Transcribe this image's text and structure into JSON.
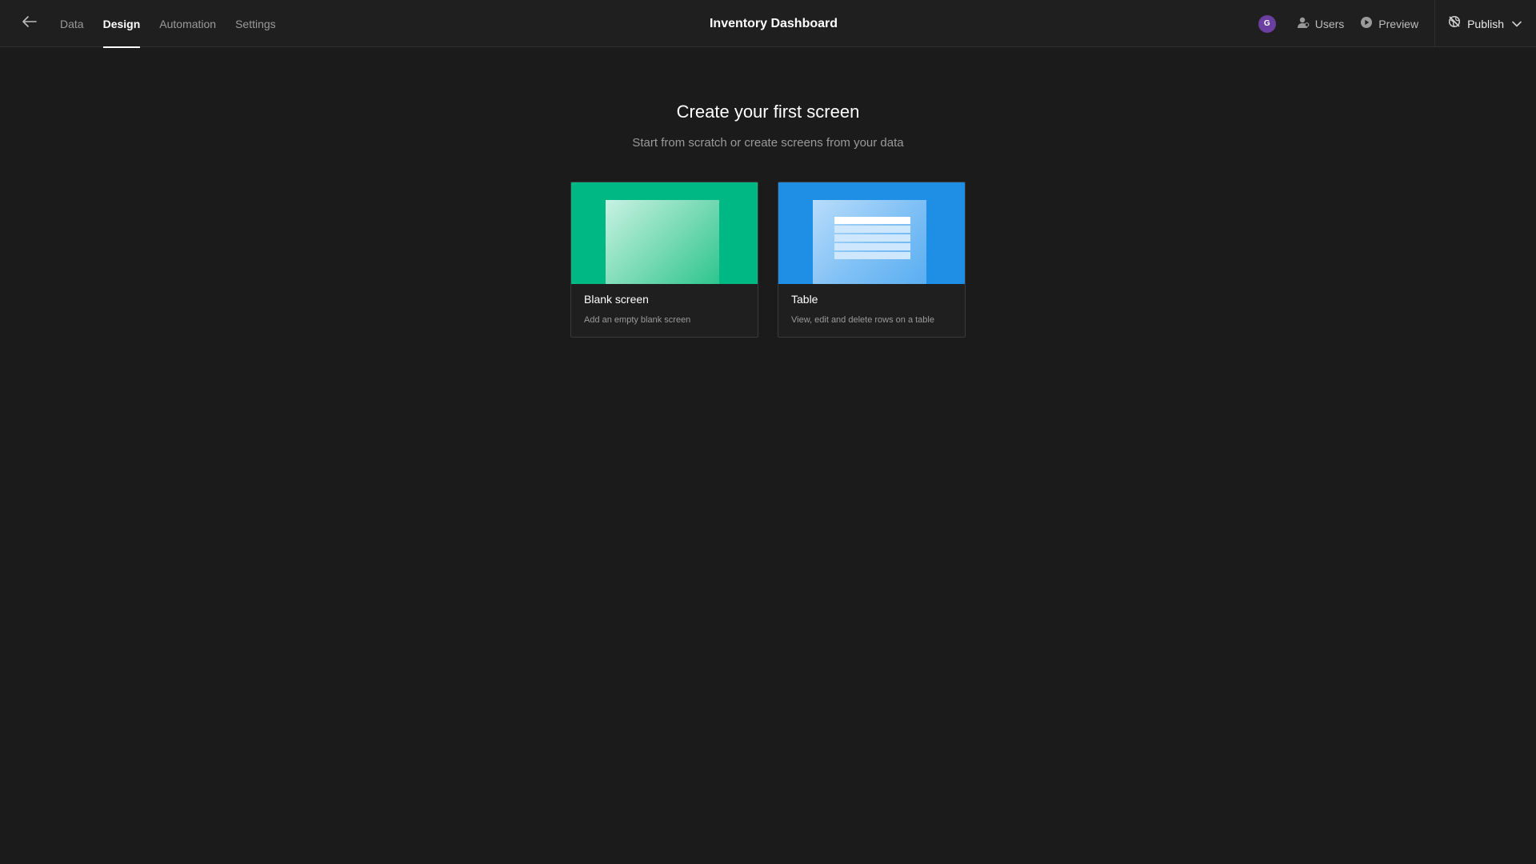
{
  "header": {
    "back_icon": "arrow-left-icon",
    "tabs": [
      {
        "label": "Data",
        "active": false
      },
      {
        "label": "Design",
        "active": true
      },
      {
        "label": "Automation",
        "active": false
      },
      {
        "label": "Settings",
        "active": false
      }
    ],
    "title": "Inventory Dashboard",
    "avatar_initial": "G",
    "avatar_color": "#6b3fa0",
    "users_label": "Users",
    "users_icon": "user-icon",
    "preview_label": "Preview",
    "preview_icon": "play-circle-icon",
    "publish_label": "Publish",
    "publish_icon": "globe-strike-icon",
    "publish_chevron_icon": "chevron-down-icon"
  },
  "main": {
    "heading": "Create your first screen",
    "subheading": "Start from scratch or create screens from your data",
    "cards": [
      {
        "title": "Blank screen",
        "description": "Add an empty blank screen",
        "accent": "#00b884"
      },
      {
        "title": "Table",
        "description": "View, edit and delete rows on a table",
        "accent": "#1f8fe5"
      }
    ]
  }
}
